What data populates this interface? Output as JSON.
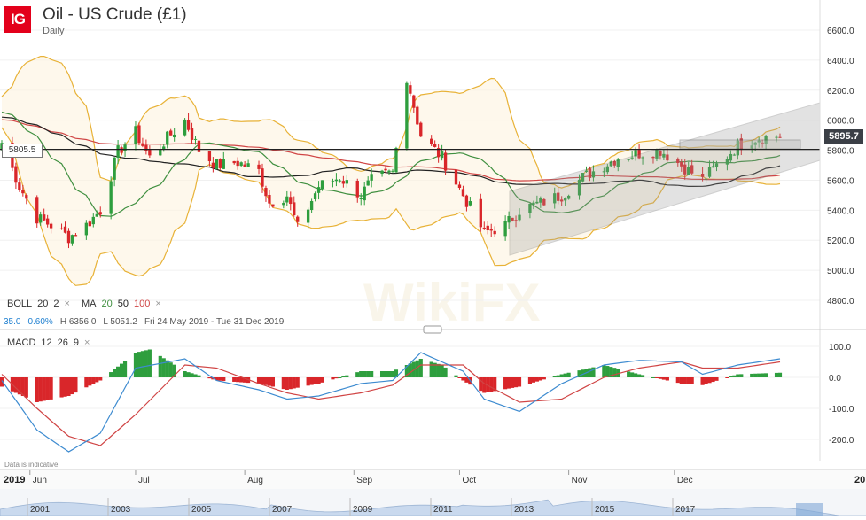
{
  "header": {
    "logo_text": "IG",
    "instrument_title": "Oil - US Crude (£1)",
    "timeframe": "Daily"
  },
  "indicators": {
    "boll_label": "BOLL",
    "boll_p1": "20",
    "boll_p2": "2",
    "ma_label": "MA",
    "ma_20": "20",
    "ma_50": "50",
    "ma_100": "100",
    "close_glyph": "×",
    "macd_label": "MACD",
    "macd_p1": "12",
    "macd_p2": "26",
    "macd_p3": "9"
  },
  "stats": {
    "value1": "35.0",
    "value2": "0.60%",
    "high": "H 6356.0",
    "low": "L 5051.2",
    "range": "Fri 24 May 2019 - Tue 31 Dec 2019"
  },
  "price_tag": "5895.7",
  "level_tag": "5805.5",
  "footer_note": "Data is indicative",
  "colors": {
    "up": "#2e9e3e",
    "down": "#d9262a",
    "boll": "#e8b237",
    "ma20": "#3f8f3f",
    "ma50": "#222222",
    "ma100": "#d04545",
    "macd_line": "#3d8bd0",
    "signal_line": "#d04545"
  },
  "chart_data": [
    {
      "type": "candlestick",
      "y_axis_ticks": [
        "6600.0",
        "6400.0",
        "6200.0",
        "6000.0",
        "5800.0",
        "5600.0",
        "5400.0",
        "5200.0",
        "5000.0",
        "4800.0"
      ],
      "ylim": [
        4700,
        6700
      ],
      "x_axis_labels": [
        "Jun",
        "Jul",
        "Aug",
        "Sep",
        "Oct",
        "Nov",
        "Dec"
      ],
      "range_note": "Fri 24 May 2019 - Tue 31 Dec 2019",
      "high": 6356.0,
      "low": 5051.2,
      "last": 5895.7,
      "horizontal_level": 5805.5,
      "close_path": [
        {
          "date": "2019-05-24",
          "value": 5850
        },
        {
          "date": "2019-05-29",
          "value": 5560
        },
        {
          "date": "2019-06-03",
          "value": 5350
        },
        {
          "date": "2019-06-07",
          "value": 5300
        },
        {
          "date": "2019-06-12",
          "value": 5220
        },
        {
          "date": "2019-06-17",
          "value": 5300
        },
        {
          "date": "2019-06-21",
          "value": 5400
        },
        {
          "date": "2019-06-26",
          "value": 5790
        },
        {
          "date": "2019-07-01",
          "value": 5920
        },
        {
          "date": "2019-07-05",
          "value": 5750
        },
        {
          "date": "2019-07-10",
          "value": 5880
        },
        {
          "date": "2019-07-15",
          "value": 6000
        },
        {
          "date": "2019-07-19",
          "value": 5800
        },
        {
          "date": "2019-07-24",
          "value": 5700
        },
        {
          "date": "2019-07-30",
          "value": 5720
        },
        {
          "date": "2019-08-05",
          "value": 5660
        },
        {
          "date": "2019-08-08",
          "value": 5450
        },
        {
          "date": "2019-08-13",
          "value": 5500
        },
        {
          "date": "2019-08-16",
          "value": 5280
        },
        {
          "date": "2019-08-22",
          "value": 5560
        },
        {
          "date": "2019-08-28",
          "value": 5620
        },
        {
          "date": "2019-09-03",
          "value": 5500
        },
        {
          "date": "2019-09-06",
          "value": 5600
        },
        {
          "date": "2019-09-12",
          "value": 5650
        },
        {
          "date": "2019-09-16",
          "value": 6290
        },
        {
          "date": "2019-09-20",
          "value": 5900
        },
        {
          "date": "2019-09-26",
          "value": 5750
        },
        {
          "date": "2019-10-02",
          "value": 5500
        },
        {
          "date": "2019-10-08",
          "value": 5250
        },
        {
          "date": "2019-10-14",
          "value": 5300
        },
        {
          "date": "2019-10-18",
          "value": 5400
        },
        {
          "date": "2019-10-24",
          "value": 5450
        },
        {
          "date": "2019-10-30",
          "value": 5500
        },
        {
          "date": "2019-11-05",
          "value": 5620
        },
        {
          "date": "2019-11-11",
          "value": 5700
        },
        {
          "date": "2019-11-15",
          "value": 5750
        },
        {
          "date": "2019-11-21",
          "value": 5780
        },
        {
          "date": "2019-11-27",
          "value": 5800
        },
        {
          "date": "2019-12-03",
          "value": 5700
        },
        {
          "date": "2019-12-09",
          "value": 5600
        },
        {
          "date": "2019-12-13",
          "value": 5700
        },
        {
          "date": "2019-12-19",
          "value": 5830
        },
        {
          "date": "2019-12-24",
          "value": 5880
        },
        {
          "date": "2019-12-31",
          "value": 5895.7
        }
      ]
    },
    {
      "type": "bar",
      "name": "MACD",
      "y_axis_ticks": [
        "100.0",
        "0.0",
        "-100.0",
        "-200.0"
      ],
      "ylim": [
        -260,
        140
      ],
      "histogram_path": [
        {
          "date": "2019-05-24",
          "value": -30
        },
        {
          "date": "2019-06-03",
          "value": -80
        },
        {
          "date": "2019-06-12",
          "value": -60
        },
        {
          "date": "2019-06-21",
          "value": -10
        },
        {
          "date": "2019-07-01",
          "value": 80
        },
        {
          "date": "2019-07-05",
          "value": 90
        },
        {
          "date": "2019-07-15",
          "value": 20
        },
        {
          "date": "2019-07-24",
          "value": -10
        },
        {
          "date": "2019-08-05",
          "value": -20
        },
        {
          "date": "2019-08-13",
          "value": -40
        },
        {
          "date": "2019-08-22",
          "value": -20
        },
        {
          "date": "2019-09-03",
          "value": 20
        },
        {
          "date": "2019-09-12",
          "value": 20
        },
        {
          "date": "2019-09-20",
          "value": 60
        },
        {
          "date": "2019-09-26",
          "value": 40
        },
        {
          "date": "2019-10-02",
          "value": -10
        },
        {
          "date": "2019-10-08",
          "value": -50
        },
        {
          "date": "2019-10-18",
          "value": -30
        },
        {
          "date": "2019-10-30",
          "value": 10
        },
        {
          "date": "2019-11-11",
          "value": 40
        },
        {
          "date": "2019-11-21",
          "value": 10
        },
        {
          "date": "2019-12-03",
          "value": -20
        },
        {
          "date": "2019-12-09",
          "value": -25
        },
        {
          "date": "2019-12-19",
          "value": 10
        },
        {
          "date": "2019-12-31",
          "value": 15
        }
      ],
      "macd_path": [
        {
          "date": "2019-05-24",
          "value": -10
        },
        {
          "date": "2019-06-03",
          "value": -170
        },
        {
          "date": "2019-06-12",
          "value": -240
        },
        {
          "date": "2019-06-21",
          "value": -180
        },
        {
          "date": "2019-07-01",
          "value": 30
        },
        {
          "date": "2019-07-15",
          "value": 60
        },
        {
          "date": "2019-07-24",
          "value": -10
        },
        {
          "date": "2019-08-05",
          "value": -40
        },
        {
          "date": "2019-08-13",
          "value": -70
        },
        {
          "date": "2019-08-22",
          "value": -60
        },
        {
          "date": "2019-09-03",
          "value": -20
        },
        {
          "date": "2019-09-12",
          "value": -10
        },
        {
          "date": "2019-09-20",
          "value": 80
        },
        {
          "date": "2019-10-02",
          "value": 20
        },
        {
          "date": "2019-10-08",
          "value": -70
        },
        {
          "date": "2019-10-18",
          "value": -110
        },
        {
          "date": "2019-10-30",
          "value": -20
        },
        {
          "date": "2019-11-11",
          "value": 40
        },
        {
          "date": "2019-11-21",
          "value": 55
        },
        {
          "date": "2019-12-03",
          "value": 50
        },
        {
          "date": "2019-12-09",
          "value": 10
        },
        {
          "date": "2019-12-19",
          "value": 40
        },
        {
          "date": "2019-12-31",
          "value": 60
        }
      ],
      "signal_path": [
        {
          "date": "2019-05-24",
          "value": 10
        },
        {
          "date": "2019-06-03",
          "value": -100
        },
        {
          "date": "2019-06-12",
          "value": -190
        },
        {
          "date": "2019-06-21",
          "value": -220
        },
        {
          "date": "2019-07-01",
          "value": -120
        },
        {
          "date": "2019-07-15",
          "value": 40
        },
        {
          "date": "2019-07-24",
          "value": 30
        },
        {
          "date": "2019-08-05",
          "value": -20
        },
        {
          "date": "2019-08-13",
          "value": -50
        },
        {
          "date": "2019-08-22",
          "value": -70
        },
        {
          "date": "2019-09-03",
          "value": -50
        },
        {
          "date": "2019-09-12",
          "value": -25
        },
        {
          "date": "2019-09-20",
          "value": 40
        },
        {
          "date": "2019-10-02",
          "value": 40
        },
        {
          "date": "2019-10-08",
          "value": -20
        },
        {
          "date": "2019-10-18",
          "value": -80
        },
        {
          "date": "2019-10-30",
          "value": -70
        },
        {
          "date": "2019-11-11",
          "value": 0
        },
        {
          "date": "2019-11-21",
          "value": 30
        },
        {
          "date": "2019-12-03",
          "value": 50
        },
        {
          "date": "2019-12-09",
          "value": 30
        },
        {
          "date": "2019-12-19",
          "value": 30
        },
        {
          "date": "2019-12-31",
          "value": 50
        }
      ]
    },
    {
      "type": "area",
      "name": "navigator",
      "x_axis_labels": [
        "2001",
        "2003",
        "2005",
        "2007",
        "2009",
        "2011",
        "2013",
        "2015",
        "2017"
      ],
      "left_label": "2019",
      "right_label": "20"
    }
  ]
}
